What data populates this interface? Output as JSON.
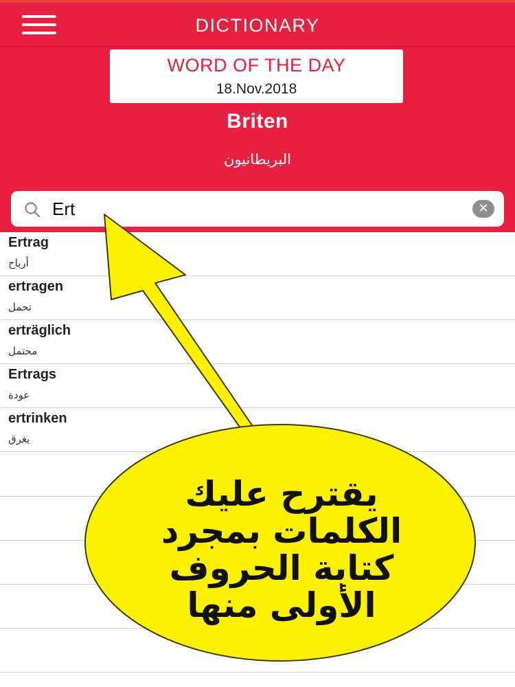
{
  "header": {
    "title": "DICTIONARY",
    "menu_icon": "hamburger-menu-icon",
    "background_color": "#e8203f"
  },
  "word_of_the_day": {
    "heading": "WORD OF THE DAY",
    "date": "18.Nov.2018",
    "word": "Briten",
    "translation": "البريطانيون"
  },
  "search": {
    "value": "Ert",
    "icon": "search-icon",
    "clear_icon": "clear-icon"
  },
  "results": [
    {
      "word": "Ertrag",
      "translation": "أرباح"
    },
    {
      "word": "ertragen",
      "translation": "تحمل"
    },
    {
      "word": "erträglich",
      "translation": "محتمل"
    },
    {
      "word": "Ertrags",
      "translation": "عودة"
    },
    {
      "word": "ertrinken",
      "translation": "يغرق"
    }
  ],
  "annotation": {
    "lines": [
      "يقترح عليك",
      "الكلمات بمجرد",
      "كتابة الحروف",
      "الأولى منها"
    ],
    "bubble_color": "#fff200",
    "arrow_color": "#fff200"
  }
}
